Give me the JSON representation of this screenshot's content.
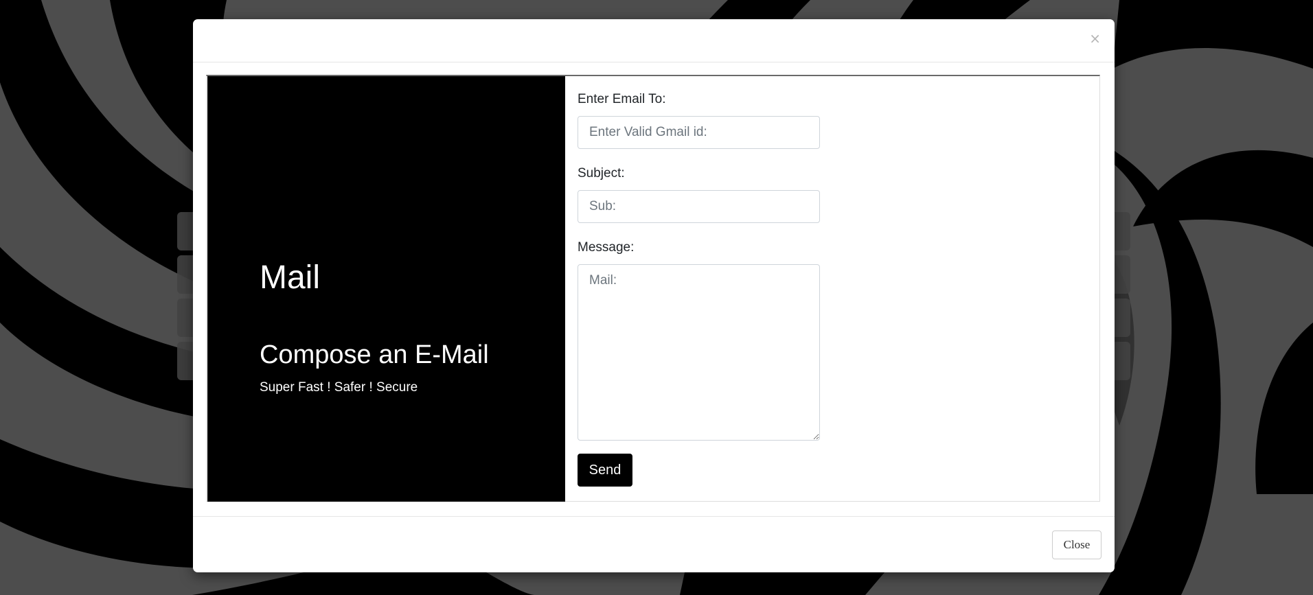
{
  "background": {
    "colors": {
      "dark": "#000000",
      "light": "#8a8a8a",
      "mid": "#5e5e5e"
    }
  },
  "modal": {
    "close_icon": "×",
    "hero": {
      "title": "Mail",
      "subtitle": "Compose an E-Mail",
      "tagline": "Super Fast ! Safer ! Secure",
      "background_color": "#000000"
    },
    "form": {
      "email_label": "Enter Email To:",
      "email_placeholder": "Enter Valid Gmail id:",
      "email_value": "",
      "subject_label": "Subject:",
      "subject_placeholder": "Sub:",
      "subject_value": "",
      "message_label": "Message:",
      "message_placeholder": "Mail:",
      "message_value": "",
      "send_label": "Send"
    },
    "footer": {
      "close_label": "Close"
    }
  }
}
